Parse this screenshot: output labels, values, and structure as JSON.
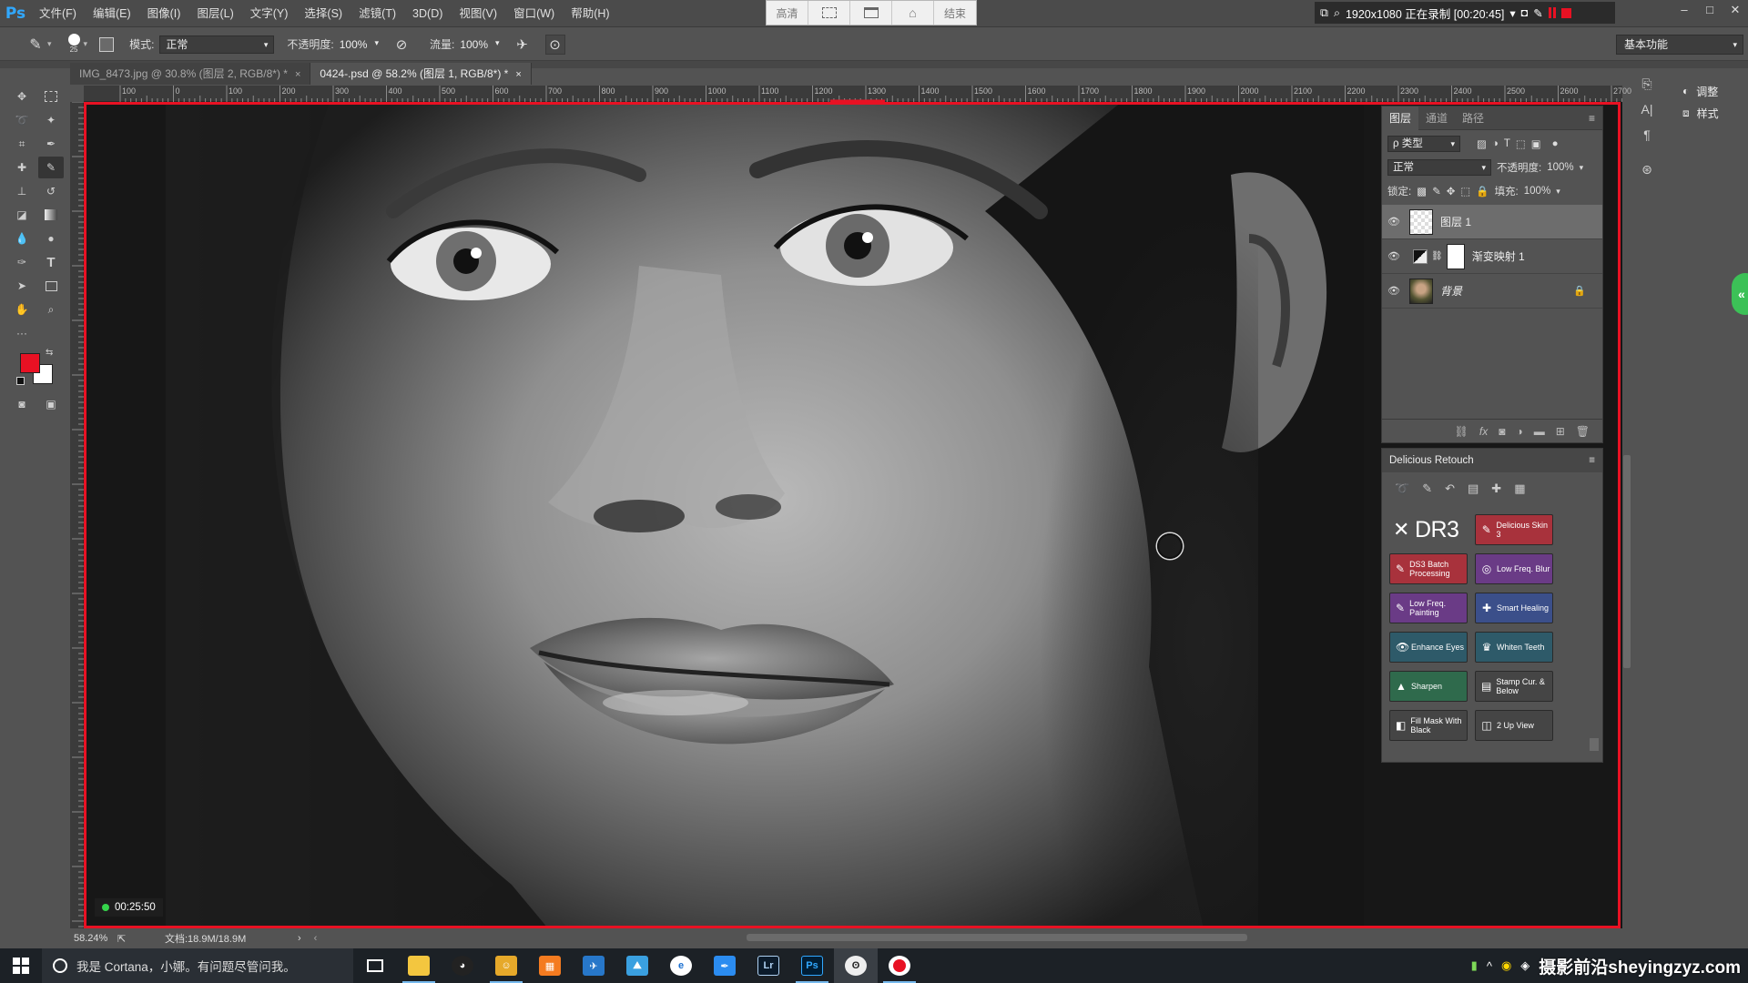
{
  "menubar": {
    "logo": "Ps",
    "items": [
      "文件(F)",
      "编辑(E)",
      "图像(I)",
      "图层(L)",
      "文字(Y)",
      "选择(S)",
      "滤镜(T)",
      "3D(D)",
      "视图(V)",
      "窗口(W)",
      "帮助(H)"
    ]
  },
  "recorder": {
    "center_labels": [
      "高清",
      "",
      "",
      "",
      "结束"
    ],
    "status": "1920x1080  正在录制 [00:20:45]"
  },
  "options": {
    "brush_size": "25",
    "mode_label": "模式:",
    "mode_value": "正常",
    "opacity_label": "不透明度:",
    "opacity_value": "100%",
    "flow_label": "流量:",
    "flow_value": "100%",
    "workspace": "基本功能"
  },
  "tabs": [
    {
      "label": "IMG_8473.jpg @ 30.8% (图层 2, RGB/8*) *",
      "close": "×"
    },
    {
      "label": "0424-.psd @ 58.2% (图层 1, RGB/8*) *",
      "close": "×"
    }
  ],
  "ruler": {
    "top_labels": [
      "100",
      "0",
      "100",
      "200",
      "300",
      "400",
      "500",
      "600",
      "700",
      "800",
      "900",
      "1000",
      "1100",
      "1200",
      "1300",
      "1400",
      "1500",
      "1600",
      "1700",
      "1800",
      "1900",
      "2000",
      "2100",
      "2200",
      "2300",
      "2400",
      "2500",
      "2600",
      "2700"
    ]
  },
  "timer": "00:25:50",
  "status": {
    "zoom": "58.24%",
    "doc": "文档:18.9M/18.9M"
  },
  "layers_panel": {
    "tabs": [
      "图层",
      "通道",
      "路径"
    ],
    "filter_label": "ρ 类型",
    "blend_mode": "正常",
    "opacity_label": "不透明度:",
    "opacity_value": "100%",
    "lock_label": "锁定:",
    "fill_label": "填充:",
    "fill_value": "100%",
    "layers": [
      {
        "name": "图层 1",
        "selected": true
      },
      {
        "name": "渐变映射 1",
        "selected": false
      },
      {
        "name": "背景",
        "selected": false
      }
    ]
  },
  "delicious_retouch": {
    "title": "Delicious Retouch",
    "logo": "DR3",
    "buttons": [
      {
        "label": "Delicious Skin 3",
        "color": "#a8323c",
        "icon": "brush-icon"
      },
      {
        "label": "DS3 Batch Processing",
        "color": "#a8323c",
        "icon": "brush-icon"
      },
      {
        "label": "Low Freq. Blur",
        "color": "#6a3b86",
        "icon": "blur-icon"
      },
      {
        "label": "Low Freq. Painting",
        "color": "#6a3b86",
        "icon": "brush-icon"
      },
      {
        "label": "Smart Healing",
        "color": "#3b4f8a",
        "icon": "heal-icon"
      },
      {
        "label": "Enhance Eyes",
        "color": "#2e5a69",
        "icon": "eye-icon"
      },
      {
        "label": "Whiten Teeth",
        "color": "#2e5a69",
        "icon": "tooth-icon"
      },
      {
        "label": "Sharpen",
        "color": "#2f6a4c",
        "icon": "triangle-icon"
      },
      {
        "label": "Stamp Cur. & Below",
        "color": "#454545",
        "icon": "stamp-icon"
      },
      {
        "label": "Fill Mask With Black",
        "color": "#454545",
        "icon": "mask-icon"
      },
      {
        "label": "2 Up View",
        "color": "#454545",
        "icon": "split-icon"
      }
    ]
  },
  "right_panel": {
    "adjust": "调整",
    "style": "样式"
  },
  "taskbar": {
    "cortana": "我是 Cortana，小娜。有问题尽管问我。",
    "watermark": "摄影前沿sheyingzyz.com"
  },
  "colors": {
    "foreground": "#e81123",
    "background": "#ffffff",
    "recording_frame": "#e81123"
  }
}
